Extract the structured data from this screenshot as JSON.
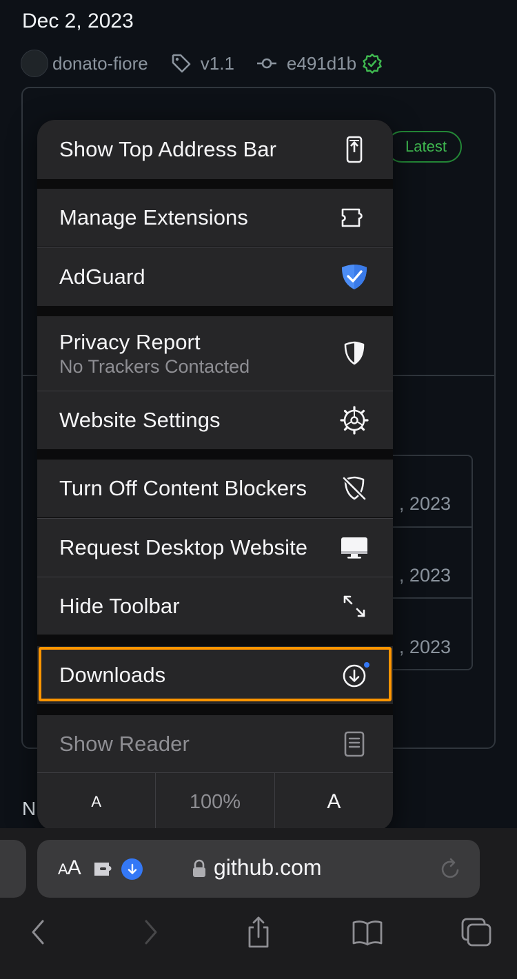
{
  "page": {
    "date": "Dec 2, 2023",
    "author": "donato-fiore",
    "tag": "v1.1",
    "commit": "e491d1b",
    "latest_badge": "Latest",
    "asset_dates": [
      ", 2023",
      ", 2023",
      ", 2023"
    ],
    "section_initial": "N"
  },
  "menu": {
    "show_top_address_bar": "Show Top Address Bar",
    "manage_extensions": "Manage Extensions",
    "adguard": "AdGuard",
    "privacy_report": "Privacy Report",
    "privacy_report_sub": "No Trackers Contacted",
    "website_settings": "Website Settings",
    "turn_off_content_blockers": "Turn Off Content Blockers",
    "request_desktop_website": "Request Desktop Website",
    "hide_toolbar": "Hide Toolbar",
    "downloads": "Downloads",
    "show_reader": "Show Reader",
    "zoom_smaller": "A",
    "zoom_level": "100%",
    "zoom_larger": "A"
  },
  "address_bar": {
    "aa_small": "A",
    "aa_large": "A",
    "url": "github.com"
  },
  "colors": {
    "highlight": "#ff9500",
    "accent_blue": "#3478f6",
    "verified_green": "#3fb950",
    "adguard_blue": "#4c8df6"
  },
  "icons": {
    "show_top_address_bar": "phone-arrow-up-icon",
    "manage_extensions": "puzzle-icon",
    "adguard": "adguard-shield-icon",
    "privacy_report": "half-shield-icon",
    "website_settings": "gear-icon",
    "turn_off_content_blockers": "shield-slash-icon",
    "request_desktop_website": "desktop-icon",
    "hide_toolbar": "expand-arrows-icon",
    "downloads": "download-circle-icon",
    "show_reader": "reader-doc-icon"
  }
}
